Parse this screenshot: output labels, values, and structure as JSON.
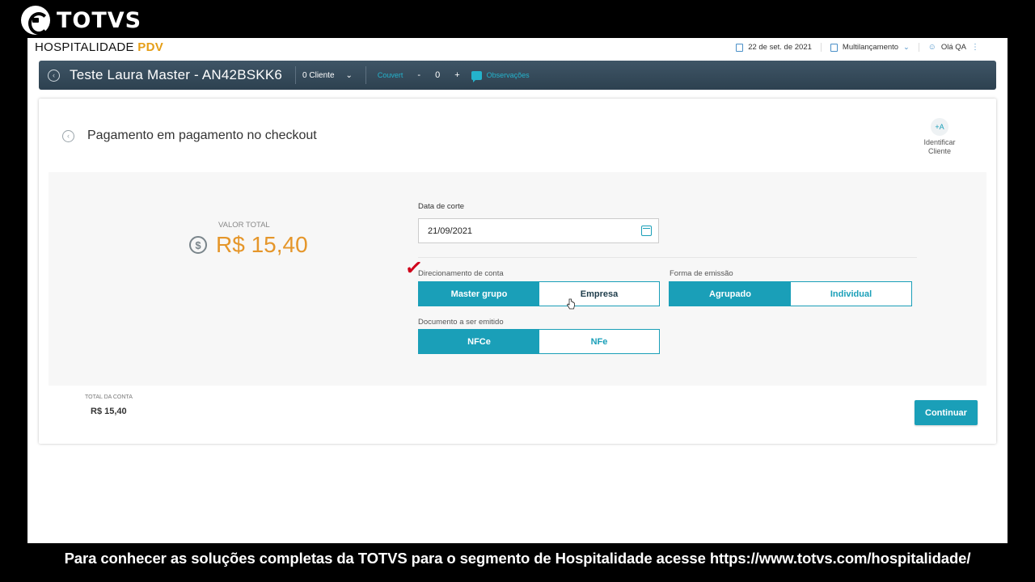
{
  "video": {
    "logo_text": "TOTVS",
    "caption": "Para conhecer as soluções completas da TOTVS para o segmento de Hospitalidade acesse https://www.totvs.com/hospitalidade/"
  },
  "app": {
    "brand_main": "HOSPITALIDADE",
    "brand_accent": "PDV",
    "date": "22 de set. de 2021",
    "mode": "Multilançamento",
    "user": "Olá QA"
  },
  "header": {
    "title": "Teste Laura Master - AN42BSKK6",
    "client_select": "0 Cliente",
    "couvert_label": "Couvert",
    "couvert_minus": "-",
    "couvert_count": "0",
    "couvert_plus": "+",
    "observations": "Observações"
  },
  "page": {
    "title": "Pagamento em pagamento no checkout",
    "identify_line1": "Identificar",
    "identify_line2": "Cliente",
    "identify_icon_text": "+A"
  },
  "payment": {
    "total_label": "VALOR TOTAL",
    "total_value": "R$ 15,40",
    "date_label": "Data de corte",
    "date_value": "21/09/2021",
    "direction_label": "Direcionamento de conta",
    "direction_options": [
      "Master grupo",
      "Empresa"
    ],
    "direction_selected": "Master grupo",
    "emission_label": "Forma de emissão",
    "emission_options": [
      "Agrupado",
      "Individual"
    ],
    "emission_selected": "Agrupado",
    "document_label": "Documento a ser emitido",
    "document_options": [
      "NFCe",
      "NFe"
    ],
    "document_selected": "NFCe"
  },
  "footer": {
    "account_total_label": "TOTAL DA CONTA",
    "account_total_value": "R$ 15,40",
    "continue_label": "Continuar"
  },
  "colors": {
    "accent": "#1a9fb8",
    "amount": "#e5962a",
    "header_bg": "#34495a",
    "annotation_check": "#d0021b"
  }
}
